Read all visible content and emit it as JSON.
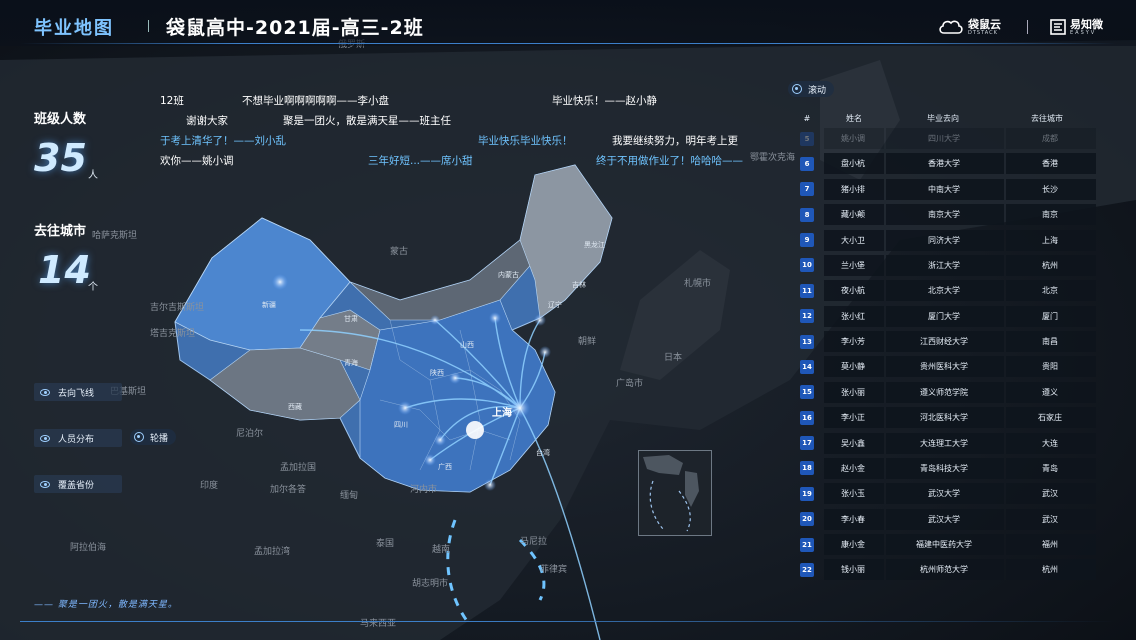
{
  "header": {
    "app_title": "毕业地图",
    "school_title": "袋鼠高中-2021届-高三-2班",
    "brand1_name": "袋鼠云",
    "brand1_sub": "DTSTACK",
    "brand2_name": "易知微",
    "brand2_sub": "EASYV"
  },
  "stats": {
    "class_size_label": "班级人数",
    "class_size_value": "35",
    "class_size_unit": "人",
    "cities_label": "去往城市",
    "cities_value": "14",
    "cities_unit": "个"
  },
  "controls": {
    "flight_label": "去向飞线",
    "distribution_label": "人员分布",
    "provinces_label": "覆盖省份",
    "carousel_label": "轮播",
    "scroll_label": "滚动"
  },
  "messages": [
    {
      "text": "12班",
      "color": "white"
    },
    {
      "text": "不想毕业啊啊啊啊啊——李小盘",
      "color": "white"
    },
    {
      "text": "毕业快乐！——赵小静",
      "color": "white"
    },
    {
      "text": "谢谢大家",
      "color": "white"
    },
    {
      "text": "聚是一团火，散是满天星——班主任",
      "color": "white"
    },
    {
      "text": "于考上清华了！——刘小乱",
      "color": "blue"
    },
    {
      "text": "毕业快乐毕业快乐！",
      "color": "blue"
    },
    {
      "text": "我要继续努力，明年考上更",
      "color": "white"
    },
    {
      "text": "欢你——姚小调",
      "color": "white"
    },
    {
      "text": "三年好短...——席小甜",
      "color": "blue"
    },
    {
      "text": "终于不用做作业了！哈哈哈——",
      "color": "blue"
    }
  ],
  "footer": {
    "slogan": "—— 聚是一团火，散是满天星。"
  },
  "table": {
    "headers": [
      "#",
      "姓名",
      "毕业去向",
      "去往城市"
    ],
    "rows": [
      {
        "no": "5",
        "name": "姚小调",
        "school": "四川大学",
        "city": "成都",
        "faded": true
      },
      {
        "no": "6",
        "name": "盘小杭",
        "school": "香港大学",
        "city": "香港"
      },
      {
        "no": "7",
        "name": "猪小排",
        "school": "中南大学",
        "city": "长沙"
      },
      {
        "no": "8",
        "name": "藏小颠",
        "school": "南京大学",
        "city": "南京"
      },
      {
        "no": "9",
        "name": "大小卫",
        "school": "同济大学",
        "city": "上海"
      },
      {
        "no": "10",
        "name": "兰小堡",
        "school": "浙江大学",
        "city": "杭州"
      },
      {
        "no": "11",
        "name": "夜小航",
        "school": "北京大学",
        "city": "北京"
      },
      {
        "no": "12",
        "name": "张小红",
        "school": "厦门大学",
        "city": "厦门"
      },
      {
        "no": "13",
        "name": "李小芳",
        "school": "江西财经大学",
        "city": "南昌"
      },
      {
        "no": "14",
        "name": "莫小静",
        "school": "贵州医科大学",
        "city": "贵阳"
      },
      {
        "no": "15",
        "name": "张小丽",
        "school": "遵义师范学院",
        "city": "遵义"
      },
      {
        "no": "16",
        "name": "李小正",
        "school": "河北医科大学",
        "city": "石家庄"
      },
      {
        "no": "17",
        "name": "吴小鑫",
        "school": "大连理工大学",
        "city": "大连"
      },
      {
        "no": "18",
        "name": "赵小金",
        "school": "青岛科技大学",
        "city": "青岛"
      },
      {
        "no": "19",
        "name": "张小玉",
        "school": "武汉大学",
        "city": "武汉"
      },
      {
        "no": "20",
        "name": "李小春",
        "school": "武汉大学",
        "city": "武汉"
      },
      {
        "no": "21",
        "name": "康小金",
        "school": "福建中医药大学",
        "city": "福州"
      },
      {
        "no": "22",
        "name": "钱小丽",
        "school": "杭州师范大学",
        "city": "杭州"
      }
    ]
  },
  "map_labels": {
    "countries": [
      "俄罗斯",
      "哈萨克斯坦",
      "吉尔吉斯斯坦",
      "塔吉克斯坦",
      "阿富汗",
      "巴基斯坦",
      "蒙古",
      "印度",
      "尼泊尔",
      "孟加拉国",
      "缅甸",
      "泰国",
      "越南",
      "柬埔寨",
      "菲律宾",
      "马来西亚",
      "日本",
      "朝鲜",
      "韩国",
      "新加坡",
      "印度尼西亚",
      "斯里兰卡",
      "不丹",
      "老挝",
      "文莱",
      "东帝汶",
      "鄂霍次克海",
      "札幌市",
      "广岛市",
      "加尔各答",
      "河内市",
      "曼谷",
      "金边市",
      "胡志明市",
      "马尼拉",
      "中国台湾",
      "雅加达",
      "加里曼丹",
      "新德里",
      "阿拉伯海",
      "孟加拉湾",
      "南海",
      "北马里亚纳群岛",
      "关岛",
      "马绍尔群岛",
      "帕劳"
    ],
    "provinces": [
      "新疆",
      "西藏",
      "青海",
      "甘肃",
      "内蒙古",
      "黑龙江",
      "吉林",
      "辽宁",
      "北京",
      "天津",
      "河北",
      "山西",
      "陕西",
      "宁夏",
      "山东",
      "河南",
      "江苏",
      "安徽",
      "湖北",
      "重庆",
      "四川",
      "贵州",
      "云南",
      "湖南",
      "江西",
      "浙江",
      "福建",
      "广东",
      "广西",
      "海南",
      "台湾",
      "上海"
    ]
  },
  "colors": {
    "accent": "#6fc4ff",
    "province_fill": "#4c7fc0",
    "number_badge": "#1f57b8"
  }
}
